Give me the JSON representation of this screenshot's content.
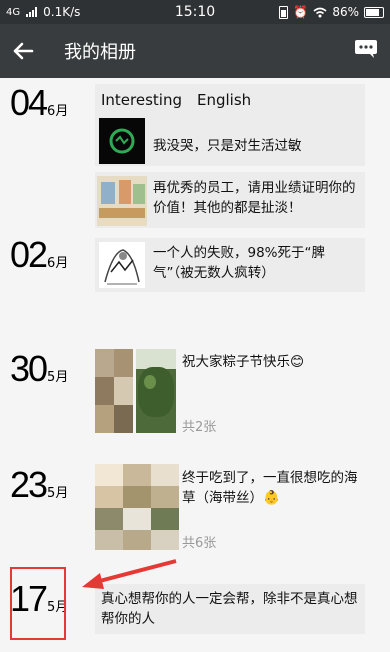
{
  "status_bar": {
    "network": "4G",
    "speed": "0.1K/s",
    "time": "15:10",
    "battery": "86%"
  },
  "header": {
    "title": "我的相册"
  },
  "posts": [
    {
      "day": "04",
      "month": "6月",
      "items": [
        {
          "text": "Interesting　English"
        },
        {
          "text": "我没哭，只是对生活过敏"
        },
        {
          "text": "再优秀的员工，请用业绩证明你的价值！其他的都是扯淡！"
        }
      ]
    },
    {
      "day": "02",
      "month": "6月",
      "items": [
        {
          "text": "一个人的失败，98%死于“脾气”（被无数人疯转）"
        }
      ]
    },
    {
      "day": "30",
      "month": "5月",
      "items": [
        {
          "text": "祝大家粽子节快乐😊",
          "count": "共2张"
        }
      ]
    },
    {
      "day": "23",
      "month": "5月",
      "items": [
        {
          "text": "终于吃到了，一直很想吃的海草（海带丝）👶",
          "count": "共6张"
        }
      ]
    },
    {
      "day": "17",
      "month": "5月",
      "items": [
        {
          "text": "真心想帮你的人一定会帮，除非不是真心想帮你的人"
        }
      ]
    }
  ],
  "colors": {
    "titlebar": "#383c3e",
    "statusbar": "#2f3234",
    "highlight": "#e53935"
  }
}
